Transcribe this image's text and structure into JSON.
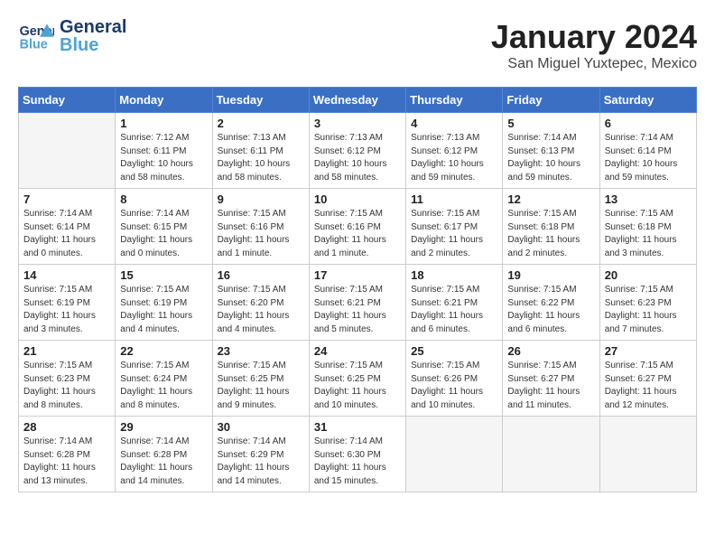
{
  "header": {
    "logo_general": "General",
    "logo_blue": "Blue",
    "title": "January 2024",
    "subtitle": "San Miguel Yuxtepec, Mexico"
  },
  "days_of_week": [
    "Sunday",
    "Monday",
    "Tuesday",
    "Wednesday",
    "Thursday",
    "Friday",
    "Saturday"
  ],
  "weeks": [
    [
      {
        "day": "",
        "info": ""
      },
      {
        "day": "1",
        "info": "Sunrise: 7:12 AM\nSunset: 6:11 PM\nDaylight: 10 hours\nand 58 minutes."
      },
      {
        "day": "2",
        "info": "Sunrise: 7:13 AM\nSunset: 6:11 PM\nDaylight: 10 hours\nand 58 minutes."
      },
      {
        "day": "3",
        "info": "Sunrise: 7:13 AM\nSunset: 6:12 PM\nDaylight: 10 hours\nand 58 minutes."
      },
      {
        "day": "4",
        "info": "Sunrise: 7:13 AM\nSunset: 6:12 PM\nDaylight: 10 hours\nand 59 minutes."
      },
      {
        "day": "5",
        "info": "Sunrise: 7:14 AM\nSunset: 6:13 PM\nDaylight: 10 hours\nand 59 minutes."
      },
      {
        "day": "6",
        "info": "Sunrise: 7:14 AM\nSunset: 6:14 PM\nDaylight: 10 hours\nand 59 minutes."
      }
    ],
    [
      {
        "day": "7",
        "info": "Sunrise: 7:14 AM\nSunset: 6:14 PM\nDaylight: 11 hours\nand 0 minutes."
      },
      {
        "day": "8",
        "info": "Sunrise: 7:14 AM\nSunset: 6:15 PM\nDaylight: 11 hours\nand 0 minutes."
      },
      {
        "day": "9",
        "info": "Sunrise: 7:15 AM\nSunset: 6:16 PM\nDaylight: 11 hours\nand 1 minute."
      },
      {
        "day": "10",
        "info": "Sunrise: 7:15 AM\nSunset: 6:16 PM\nDaylight: 11 hours\nand 1 minute."
      },
      {
        "day": "11",
        "info": "Sunrise: 7:15 AM\nSunset: 6:17 PM\nDaylight: 11 hours\nand 2 minutes."
      },
      {
        "day": "12",
        "info": "Sunrise: 7:15 AM\nSunset: 6:18 PM\nDaylight: 11 hours\nand 2 minutes."
      },
      {
        "day": "13",
        "info": "Sunrise: 7:15 AM\nSunset: 6:18 PM\nDaylight: 11 hours\nand 3 minutes."
      }
    ],
    [
      {
        "day": "14",
        "info": "Sunrise: 7:15 AM\nSunset: 6:19 PM\nDaylight: 11 hours\nand 3 minutes."
      },
      {
        "day": "15",
        "info": "Sunrise: 7:15 AM\nSunset: 6:19 PM\nDaylight: 11 hours\nand 4 minutes."
      },
      {
        "day": "16",
        "info": "Sunrise: 7:15 AM\nSunset: 6:20 PM\nDaylight: 11 hours\nand 4 minutes."
      },
      {
        "day": "17",
        "info": "Sunrise: 7:15 AM\nSunset: 6:21 PM\nDaylight: 11 hours\nand 5 minutes."
      },
      {
        "day": "18",
        "info": "Sunrise: 7:15 AM\nSunset: 6:21 PM\nDaylight: 11 hours\nand 6 minutes."
      },
      {
        "day": "19",
        "info": "Sunrise: 7:15 AM\nSunset: 6:22 PM\nDaylight: 11 hours\nand 6 minutes."
      },
      {
        "day": "20",
        "info": "Sunrise: 7:15 AM\nSunset: 6:23 PM\nDaylight: 11 hours\nand 7 minutes."
      }
    ],
    [
      {
        "day": "21",
        "info": "Sunrise: 7:15 AM\nSunset: 6:23 PM\nDaylight: 11 hours\nand 8 minutes."
      },
      {
        "day": "22",
        "info": "Sunrise: 7:15 AM\nSunset: 6:24 PM\nDaylight: 11 hours\nand 8 minutes."
      },
      {
        "day": "23",
        "info": "Sunrise: 7:15 AM\nSunset: 6:25 PM\nDaylight: 11 hours\nand 9 minutes."
      },
      {
        "day": "24",
        "info": "Sunrise: 7:15 AM\nSunset: 6:25 PM\nDaylight: 11 hours\nand 10 minutes."
      },
      {
        "day": "25",
        "info": "Sunrise: 7:15 AM\nSunset: 6:26 PM\nDaylight: 11 hours\nand 10 minutes."
      },
      {
        "day": "26",
        "info": "Sunrise: 7:15 AM\nSunset: 6:27 PM\nDaylight: 11 hours\nand 11 minutes."
      },
      {
        "day": "27",
        "info": "Sunrise: 7:15 AM\nSunset: 6:27 PM\nDaylight: 11 hours\nand 12 minutes."
      }
    ],
    [
      {
        "day": "28",
        "info": "Sunrise: 7:14 AM\nSunset: 6:28 PM\nDaylight: 11 hours\nand 13 minutes."
      },
      {
        "day": "29",
        "info": "Sunrise: 7:14 AM\nSunset: 6:28 PM\nDaylight: 11 hours\nand 14 minutes."
      },
      {
        "day": "30",
        "info": "Sunrise: 7:14 AM\nSunset: 6:29 PM\nDaylight: 11 hours\nand 14 minutes."
      },
      {
        "day": "31",
        "info": "Sunrise: 7:14 AM\nSunset: 6:30 PM\nDaylight: 11 hours\nand 15 minutes."
      },
      {
        "day": "",
        "info": ""
      },
      {
        "day": "",
        "info": ""
      },
      {
        "day": "",
        "info": ""
      }
    ]
  ]
}
